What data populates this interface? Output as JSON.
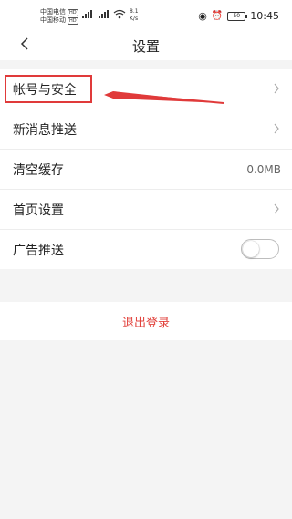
{
  "status_bar": {
    "carrier1": "中国电信",
    "carrier2": "中国移动",
    "hd": "HD",
    "network": "4G",
    "speed_value": "8.1",
    "speed_unit": "K/s",
    "battery": "50",
    "time": "10:45"
  },
  "header": {
    "title": "设置"
  },
  "settings": {
    "items": [
      {
        "label": "帐号与安全"
      },
      {
        "label": "新消息推送"
      },
      {
        "label": "清空缓存",
        "value": "0.0MB"
      },
      {
        "label": "首页设置"
      },
      {
        "label": "广告推送",
        "toggle_on": false
      }
    ]
  },
  "logout": {
    "label": "退出登录"
  },
  "colors": {
    "accent_red": "#e2423c",
    "annotation_red": "#e03a3a",
    "background": "#f4f4f4"
  },
  "icons": {
    "back": "chevron-left-icon",
    "row_chevron": "chevron-right-icon"
  }
}
